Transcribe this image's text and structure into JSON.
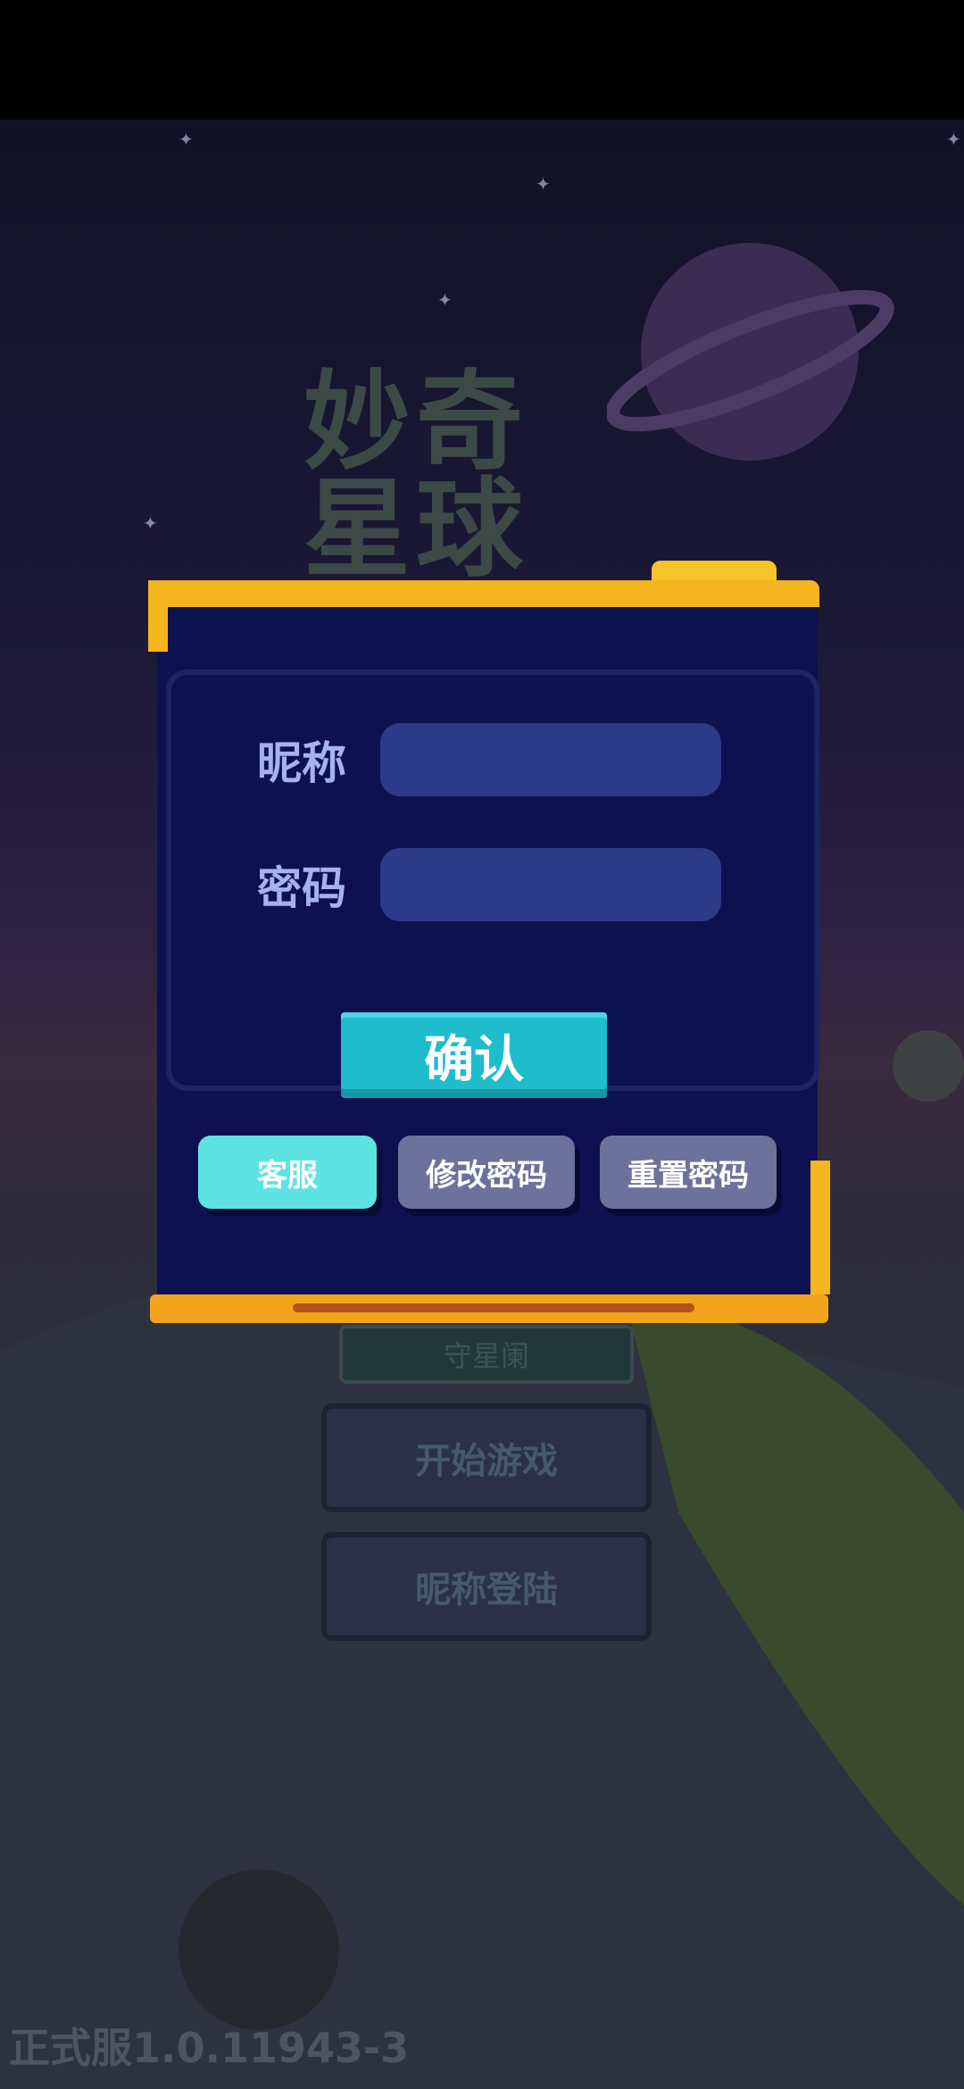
{
  "background": {
    "game_title": "妙奇星球",
    "menu_header": "守星阑",
    "menu_start": "开始游戏",
    "menu_nick_login": "昵称登陆",
    "version": "正式服1.0.11943-3"
  },
  "dialog": {
    "nickname_label": "昵称",
    "nickname_value": "",
    "password_label": "密码",
    "password_value": "",
    "confirm_label": "确认",
    "customer_service_label": "客服",
    "change_password_label": "修改密码",
    "reset_password_label": "重置密码"
  },
  "colors": {
    "panel": "#0e1150",
    "frame": "#f5b51e",
    "input": "#2d3a88",
    "confirm": "#1fbccb",
    "customer_service": "#5ee3e3",
    "secondary_button": "#6b739c"
  }
}
